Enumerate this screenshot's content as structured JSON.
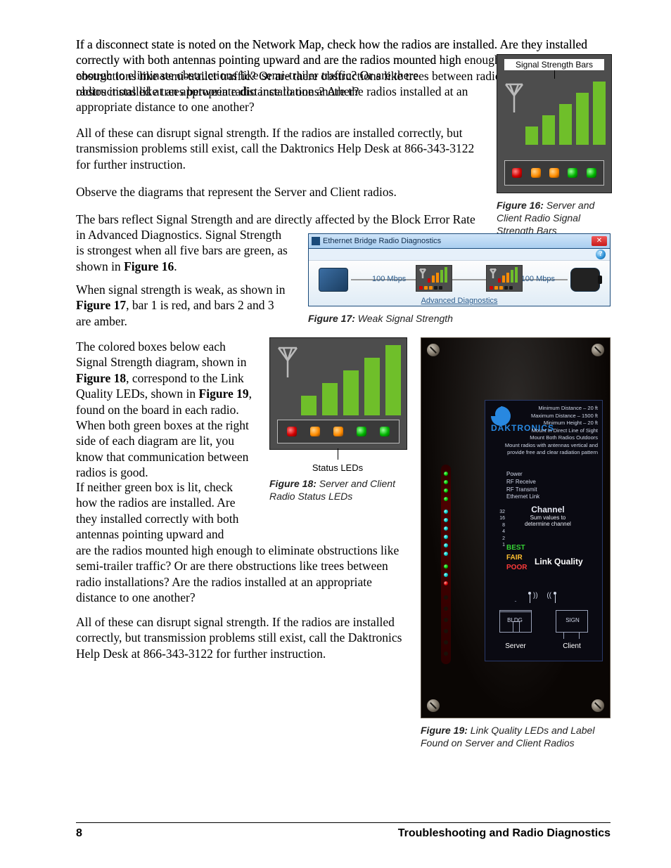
{
  "body": {
    "p1": "If a disconnect state is noted on the Network Map, check how the radios are installed. Are they installed correctly with both antennas pointing upward and are the radios mounted high enough to eliminate obstructions like semi-trailer traffic? Or are there obstructions like trees between radio installations? Are the radios installed at an appropriate distance to one another?",
    "p2": "All of these can disrupt signal strength. If the radios are installed correctly, but transmission problems still exist, call the Daktronics Help Desk at 866-343-3122 for further instruction.",
    "p3": "Observe the diagrams that represent the Server and Client radios.",
    "p4a": "The bars reflect Signal Strength and are directly affected by the Block Error Rate in Advanced Diagnostics. Signal Strength is strongest when all five bars are green, as shown in ",
    "p4b": "Figure 16",
    "p4c": ".",
    "p5a": "When signal strength is weak, as shown in ",
    "p5b": "Figure 17",
    "p5c": ", bar 1 is red, and bars 2 and 3 are amber.",
    "p6a": "The colored boxes below each Signal Strength diagram, shown in ",
    "p6b": "Figure 18",
    "p6c": ", correspond to the Link Quality LEDs, shown in ",
    "p6d": "Figure 19",
    "p6e": ", found on the board in each radio. When both green boxes at the right side of each diagram are lit, you know that communication between radios is good.",
    "p7": "If neither green box is lit, check how the radios are installed. Are they installed correctly with both antennas pointing upward and are the radios mounted high enough to eliminate obstructions like semi-trailer traffic? Or are there obstructions like trees between radio installations? Are the radios installed at an appropriate distance to one another?",
    "p8": "All of these can disrupt signal strength. If the radios are installed correctly, but transmission problems still exist, call the Daktronics Help Desk at 866-343-3122 for further instruction."
  },
  "fig16": {
    "label": "Signal Strength Bars",
    "caption_label": "Figure 16: ",
    "caption_text": "Server and Client Radio Signal Strength Bars"
  },
  "fig17": {
    "window_title": "Ethernet Bridge Radio Diagnostics",
    "close_glyph": "✕",
    "help_glyph": "?",
    "mbps": "100 Mbps",
    "adv_link": "Advanced Diagnostics",
    "caption_label": "Figure 17: ",
    "caption_text": "Weak Signal Strength"
  },
  "fig18": {
    "label": "Status LEDs",
    "caption_label": "Figure 18: ",
    "caption_text": "Server and Client Radio Status LEDs"
  },
  "fig19": {
    "brand": "DAKTRONICS",
    "specs": {
      "s1": "Minimum Distance – 20 ft",
      "s2": "Maximum Distance – 1500 ft",
      "s3": "Minimum Height – 20 ft",
      "s4": "Mount in Direct Line of Sight",
      "s5": "Mount Both Radios Outdoors",
      "s6": "Mount radios with antennas vertical and",
      "s7": "provide free and clear radiation pattern"
    },
    "status": {
      "l1": "Power",
      "l2": "RF Receive",
      "l3": "RF Transmit",
      "l4": "Ethernet Link"
    },
    "channel_title": "Channel",
    "channel_sub": "Sum values to\ndetermine channel",
    "ch": {
      "n1": "32",
      "n2": "16",
      "n3": "8",
      "n4": "4",
      "n5": "2",
      "n6": "1"
    },
    "lq_title": "Link Quality",
    "best": "BEST",
    "fair": "FAIR",
    "poor": "POOR",
    "bldg": "BLDG",
    "sign": "SIGN",
    "server": "Server",
    "client": "Client",
    "caption_label": "Figure 19: ",
    "caption_text": "Link Quality LEDs and Label Found on Server and Client Radios"
  },
  "footer": {
    "page": "8",
    "title": "Troubleshooting and Radio Diagnostics"
  }
}
